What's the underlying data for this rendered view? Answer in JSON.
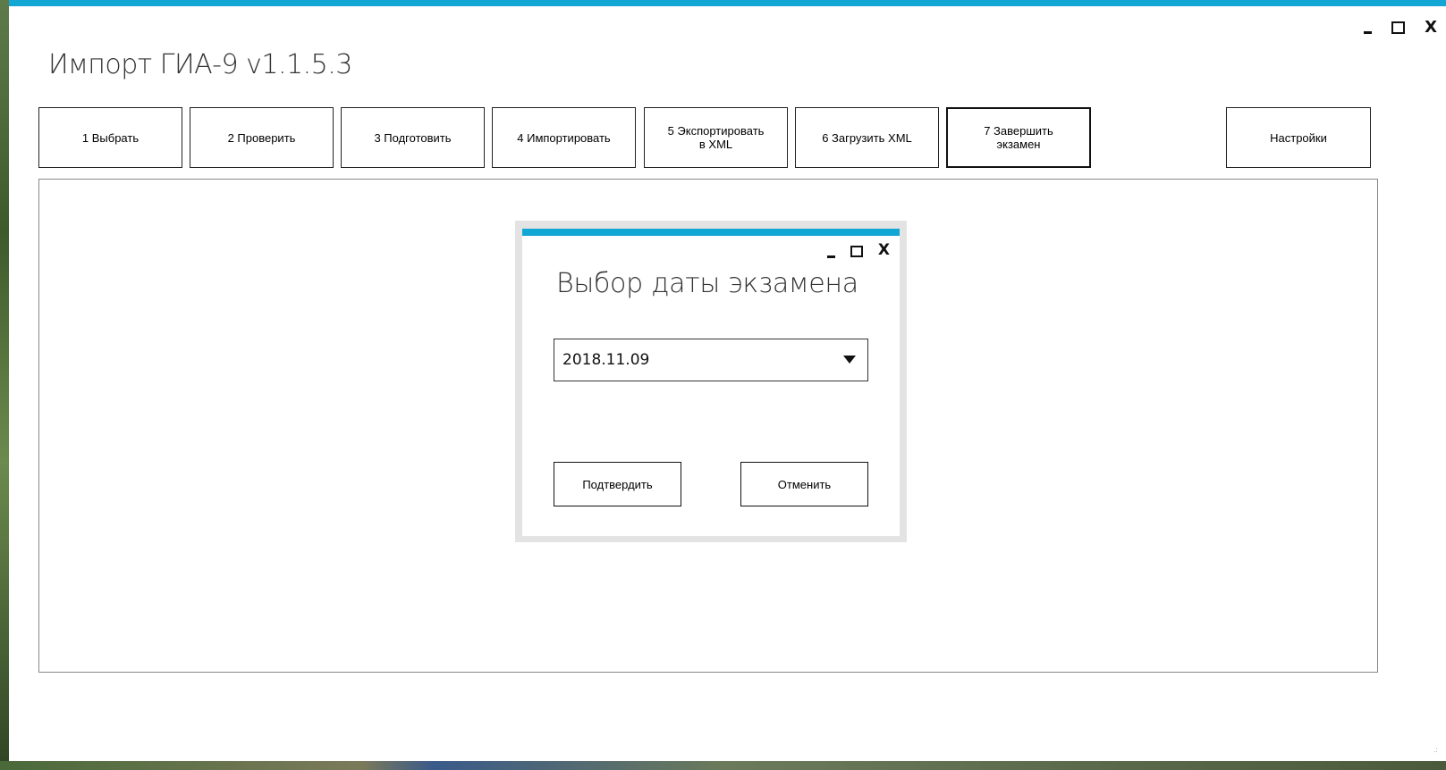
{
  "window": {
    "title": "Импорт ГИА-9 v1.1.5.3",
    "controls": {
      "minimize": "minimize",
      "maximize": "maximize",
      "close": "X"
    },
    "accent_color": "#11a6d4"
  },
  "toolbar": {
    "buttons": [
      {
        "label": "1   Выбрать"
      },
      {
        "label": "2   Проверить"
      },
      {
        "label": "3  Подготовить"
      },
      {
        "label": "4 Импортировать"
      },
      {
        "label": "5 Экспортировать\nв XML"
      },
      {
        "label": "6 Загрузить XML"
      },
      {
        "label": "7 Завершить\nэкзамен"
      }
    ],
    "settings_label": "Настройки"
  },
  "dialog": {
    "title": "Выбор даты экзамена",
    "close": "X",
    "date_select": {
      "value": "2018.11.09"
    },
    "confirm_label": "Подтвердить",
    "cancel_label": "Отменить"
  },
  "icons": {
    "window_min": "minimize-icon",
    "window_max": "maximize-icon",
    "window_close": "close-icon",
    "dropdown": "chevron-down-icon",
    "resize": "resize-grip-icon"
  }
}
